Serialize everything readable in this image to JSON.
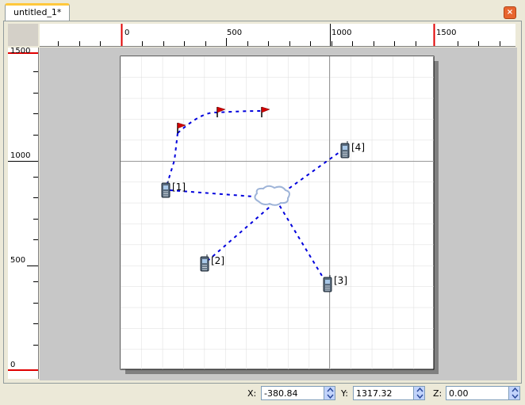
{
  "tab": {
    "title": "untitled_1*"
  },
  "close_button": {
    "label": "×"
  },
  "ruler_top": {
    "labels": [
      "0",
      "500",
      "1000",
      "1500"
    ]
  },
  "ruler_left": {
    "labels": [
      "1500",
      "1000",
      "500",
      "0"
    ]
  },
  "nodes": [
    {
      "label": "[1]"
    },
    {
      "label": "[2]"
    },
    {
      "label": "[3]"
    },
    {
      "label": "[4]"
    }
  ],
  "status": {
    "x_label": "X:",
    "x_value": "-380.84",
    "y_label": "Y:",
    "y_value": "1317.32",
    "z_label": "Z:",
    "z_value": "0.00"
  },
  "colors": {
    "tab_accent": "#ffc83c",
    "ruler_marker": "#e00000",
    "link": "#0000dd",
    "close": "#e8652f"
  }
}
